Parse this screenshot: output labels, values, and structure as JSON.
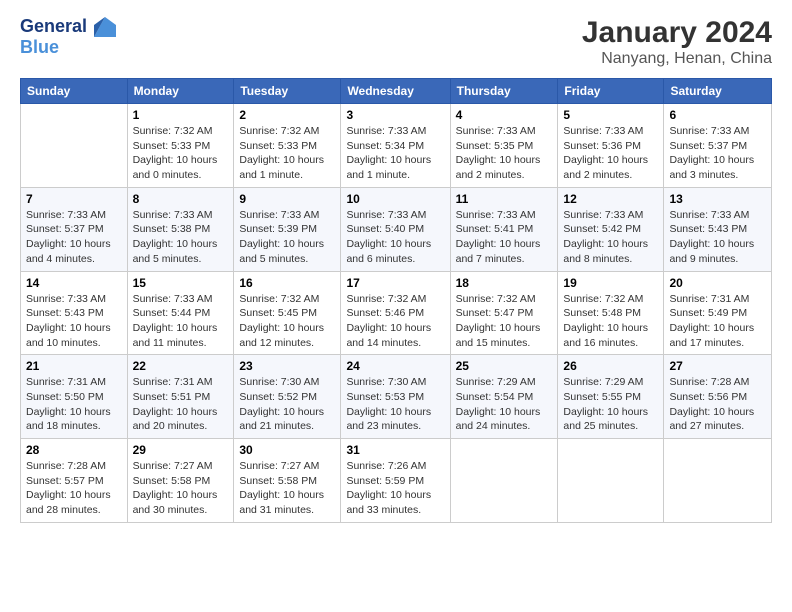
{
  "logo": {
    "line1": "General",
    "line2": "Blue"
  },
  "title": "January 2024",
  "subtitle": "Nanyang, Henan, China",
  "columns": [
    "Sunday",
    "Monday",
    "Tuesday",
    "Wednesday",
    "Thursday",
    "Friday",
    "Saturday"
  ],
  "weeks": [
    [
      {
        "day": "",
        "info": ""
      },
      {
        "day": "1",
        "info": "Sunrise: 7:32 AM\nSunset: 5:33 PM\nDaylight: 10 hours\nand 0 minutes."
      },
      {
        "day": "2",
        "info": "Sunrise: 7:32 AM\nSunset: 5:33 PM\nDaylight: 10 hours\nand 1 minute."
      },
      {
        "day": "3",
        "info": "Sunrise: 7:33 AM\nSunset: 5:34 PM\nDaylight: 10 hours\nand 1 minute."
      },
      {
        "day": "4",
        "info": "Sunrise: 7:33 AM\nSunset: 5:35 PM\nDaylight: 10 hours\nand 2 minutes."
      },
      {
        "day": "5",
        "info": "Sunrise: 7:33 AM\nSunset: 5:36 PM\nDaylight: 10 hours\nand 2 minutes."
      },
      {
        "day": "6",
        "info": "Sunrise: 7:33 AM\nSunset: 5:37 PM\nDaylight: 10 hours\nand 3 minutes."
      }
    ],
    [
      {
        "day": "7",
        "info": "Sunrise: 7:33 AM\nSunset: 5:37 PM\nDaylight: 10 hours\nand 4 minutes."
      },
      {
        "day": "8",
        "info": "Sunrise: 7:33 AM\nSunset: 5:38 PM\nDaylight: 10 hours\nand 5 minutes."
      },
      {
        "day": "9",
        "info": "Sunrise: 7:33 AM\nSunset: 5:39 PM\nDaylight: 10 hours\nand 5 minutes."
      },
      {
        "day": "10",
        "info": "Sunrise: 7:33 AM\nSunset: 5:40 PM\nDaylight: 10 hours\nand 6 minutes."
      },
      {
        "day": "11",
        "info": "Sunrise: 7:33 AM\nSunset: 5:41 PM\nDaylight: 10 hours\nand 7 minutes."
      },
      {
        "day": "12",
        "info": "Sunrise: 7:33 AM\nSunset: 5:42 PM\nDaylight: 10 hours\nand 8 minutes."
      },
      {
        "day": "13",
        "info": "Sunrise: 7:33 AM\nSunset: 5:43 PM\nDaylight: 10 hours\nand 9 minutes."
      }
    ],
    [
      {
        "day": "14",
        "info": "Sunrise: 7:33 AM\nSunset: 5:43 PM\nDaylight: 10 hours\nand 10 minutes."
      },
      {
        "day": "15",
        "info": "Sunrise: 7:33 AM\nSunset: 5:44 PM\nDaylight: 10 hours\nand 11 minutes."
      },
      {
        "day": "16",
        "info": "Sunrise: 7:32 AM\nSunset: 5:45 PM\nDaylight: 10 hours\nand 12 minutes."
      },
      {
        "day": "17",
        "info": "Sunrise: 7:32 AM\nSunset: 5:46 PM\nDaylight: 10 hours\nand 14 minutes."
      },
      {
        "day": "18",
        "info": "Sunrise: 7:32 AM\nSunset: 5:47 PM\nDaylight: 10 hours\nand 15 minutes."
      },
      {
        "day": "19",
        "info": "Sunrise: 7:32 AM\nSunset: 5:48 PM\nDaylight: 10 hours\nand 16 minutes."
      },
      {
        "day": "20",
        "info": "Sunrise: 7:31 AM\nSunset: 5:49 PM\nDaylight: 10 hours\nand 17 minutes."
      }
    ],
    [
      {
        "day": "21",
        "info": "Sunrise: 7:31 AM\nSunset: 5:50 PM\nDaylight: 10 hours\nand 18 minutes."
      },
      {
        "day": "22",
        "info": "Sunrise: 7:31 AM\nSunset: 5:51 PM\nDaylight: 10 hours\nand 20 minutes."
      },
      {
        "day": "23",
        "info": "Sunrise: 7:30 AM\nSunset: 5:52 PM\nDaylight: 10 hours\nand 21 minutes."
      },
      {
        "day": "24",
        "info": "Sunrise: 7:30 AM\nSunset: 5:53 PM\nDaylight: 10 hours\nand 23 minutes."
      },
      {
        "day": "25",
        "info": "Sunrise: 7:29 AM\nSunset: 5:54 PM\nDaylight: 10 hours\nand 24 minutes."
      },
      {
        "day": "26",
        "info": "Sunrise: 7:29 AM\nSunset: 5:55 PM\nDaylight: 10 hours\nand 25 minutes."
      },
      {
        "day": "27",
        "info": "Sunrise: 7:28 AM\nSunset: 5:56 PM\nDaylight: 10 hours\nand 27 minutes."
      }
    ],
    [
      {
        "day": "28",
        "info": "Sunrise: 7:28 AM\nSunset: 5:57 PM\nDaylight: 10 hours\nand 28 minutes."
      },
      {
        "day": "29",
        "info": "Sunrise: 7:27 AM\nSunset: 5:58 PM\nDaylight: 10 hours\nand 30 minutes."
      },
      {
        "day": "30",
        "info": "Sunrise: 7:27 AM\nSunset: 5:58 PM\nDaylight: 10 hours\nand 31 minutes."
      },
      {
        "day": "31",
        "info": "Sunrise: 7:26 AM\nSunset: 5:59 PM\nDaylight: 10 hours\nand 33 minutes."
      },
      {
        "day": "",
        "info": ""
      },
      {
        "day": "",
        "info": ""
      },
      {
        "day": "",
        "info": ""
      }
    ]
  ]
}
